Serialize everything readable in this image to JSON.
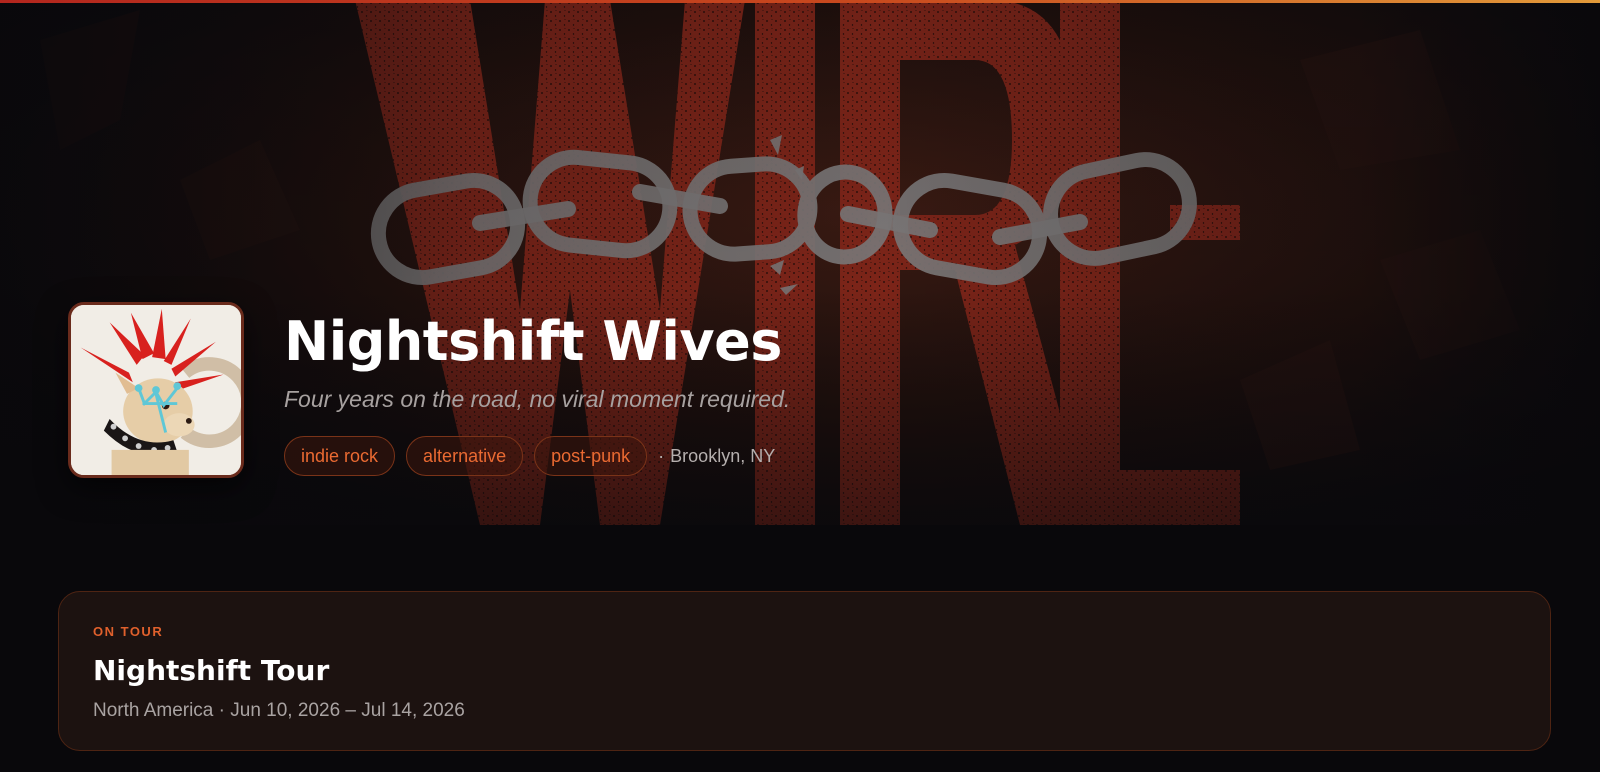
{
  "colors": {
    "background": "#09080b",
    "accent": "#e0602c",
    "tag_text": "#ea6a32",
    "tag_border": "#7a3318",
    "card_background": "#1c1210",
    "hero_red": "#7a2418"
  },
  "hero": {
    "background_art": "wire-chain-poster",
    "band_name": "Nightshift Wives",
    "tagline": "Four years on the road, no viral moment required.",
    "avatar": "punk-chihuahua-avatar",
    "tags": [
      {
        "label": "indie rock"
      },
      {
        "label": "alternative"
      },
      {
        "label": "post-punk"
      }
    ],
    "location_separator": "·",
    "location": "Brooklyn, NY"
  },
  "tour": {
    "status": "ON TOUR",
    "title": "Nightshift Tour",
    "details": "North America · Jun 10, 2026 – Jul 14, 2026"
  }
}
